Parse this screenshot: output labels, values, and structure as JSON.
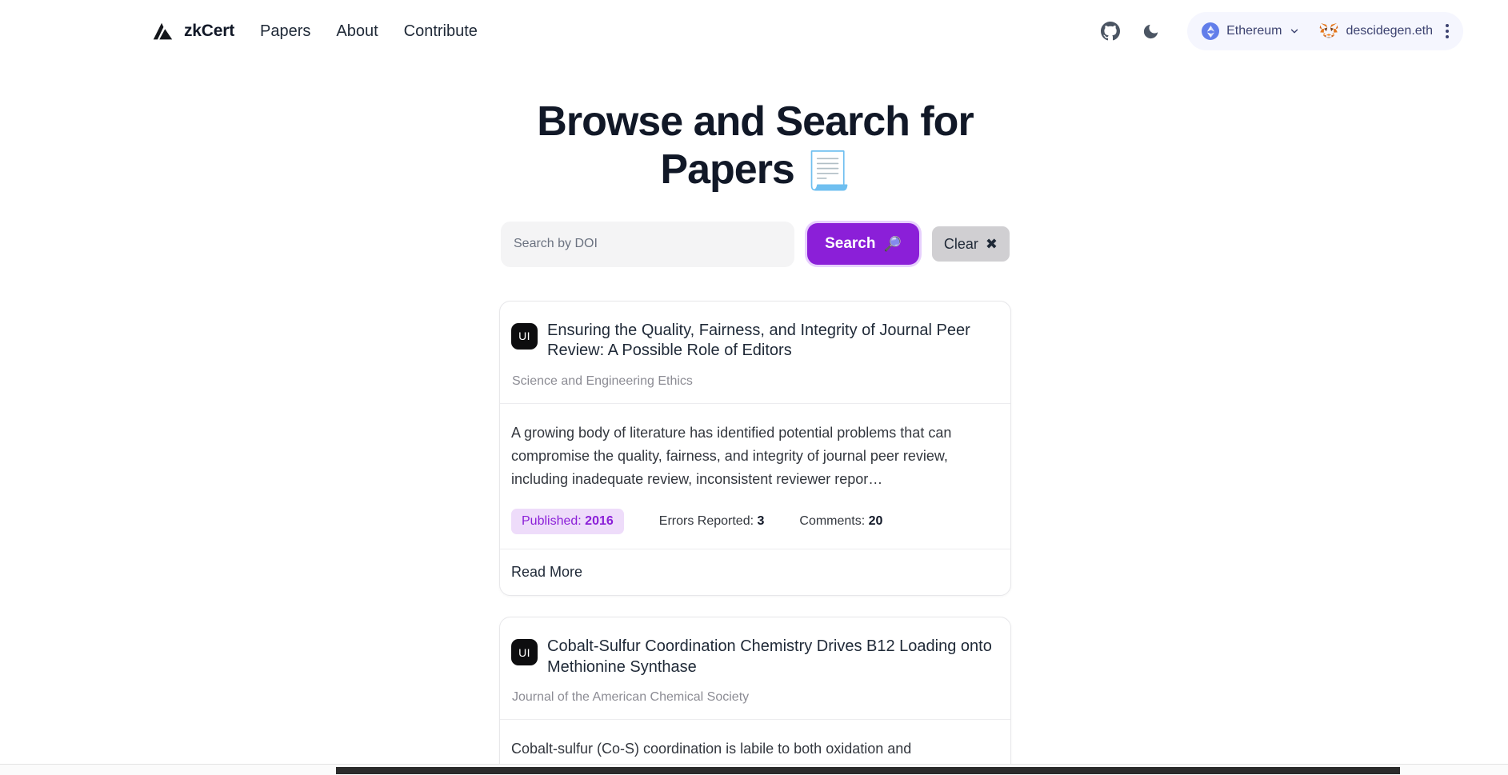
{
  "navbar": {
    "brand": {
      "logo_icon": "zkcert-mountain-logo",
      "name": "zkCert"
    },
    "links": [
      {
        "label": "Papers"
      },
      {
        "label": "About"
      },
      {
        "label": "Contribute"
      }
    ],
    "github_icon": "github-icon",
    "theme_toggle_icon": "moon-icon",
    "wallet": {
      "chain_icon": "ethereum-icon",
      "chain_name": "Ethereum",
      "chain_chevron_icon": "chevron-down-icon",
      "account_icon": "metamask-fox-icon",
      "account_name": "descidegen.eth",
      "menu_icon": "kebab-menu-icon"
    }
  },
  "main": {
    "title_text": "Browse and Search for Papers",
    "title_emoji": "📃",
    "search": {
      "value": "",
      "placeholder": "Search by DOI",
      "search_label": "Search",
      "search_emoji": "🔎",
      "clear_label": "Clear",
      "clear_emoji": "✖"
    },
    "papers": [
      {
        "avatar_initials": "UI",
        "title": "Ensuring the Quality, Fairness, and Integrity of Journal Peer Review: A Possible Role of Editors",
        "journal": "Science and Engineering Ethics",
        "abstract": "A growing body of literature has identified potential problems that can compromise the quality, fairness, and integrity of journal peer review, including inadequate review, inconsistent reviewer repor…",
        "published_label": "Published: ",
        "published_year": "2016",
        "errors_label": "Errors Reported: ",
        "errors_count": "3",
        "comments_label": "Comments: ",
        "comments_count": "20",
        "read_more_label": "Read More"
      },
      {
        "avatar_initials": "UI",
        "title": "Cobalt-Sulfur Coordination Chemistry Drives B12 Loading onto Methionine Synthase",
        "journal": "Journal of the American Chemical Society",
        "abstract": "Cobalt-sulfur (Co-S) coordination is labile to both oxidation and"
      }
    ]
  },
  "colors": {
    "accent_purple": "#8b1fd8",
    "badge_bg": "#eedcfa",
    "wallet_bg": "#f5f6fe",
    "ethereum_blue": "#627eea",
    "input_bg": "#f4f4f5",
    "clear_bg": "#d0cfd2"
  }
}
